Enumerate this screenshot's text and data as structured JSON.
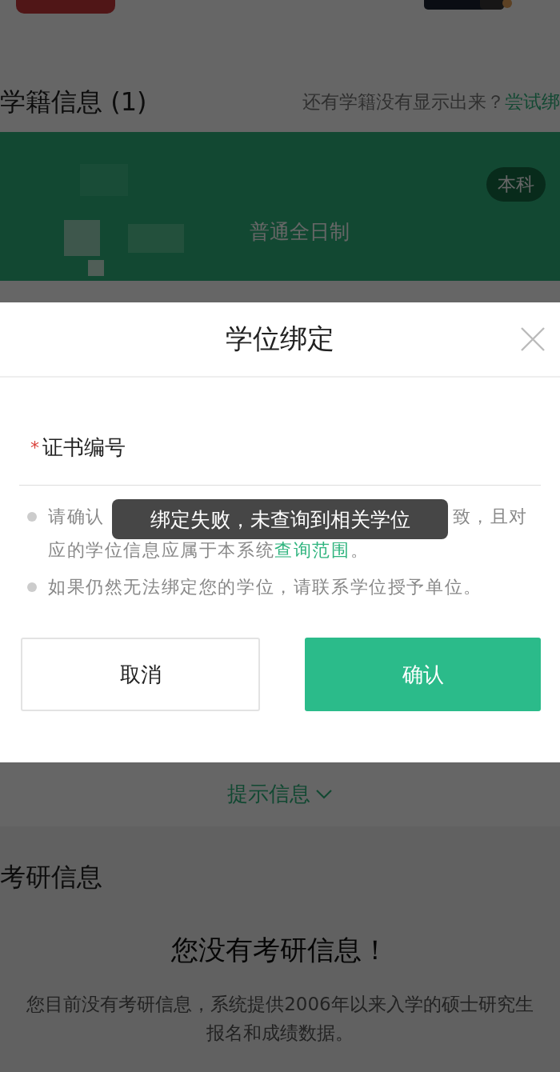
{
  "student_records": {
    "title": "学籍信息 (1)",
    "hint": "还有学籍没有显示出来？",
    "link": "尝试绑"
  },
  "record_card": {
    "badge": "本科",
    "study_mode": "普通全日制"
  },
  "hint_toggle": {
    "label": "提示信息",
    "expanded": false
  },
  "postgrad": {
    "title": "考研信息",
    "empty_title": "您没有考研信息！",
    "empty_text": "您目前没有考研信息，系统提供2006年以来入学的硕士研究生报名和成绩数据。"
  },
  "dialog": {
    "title": "学位绑定",
    "field": {
      "label": "证书编号",
      "required_mark": "*"
    },
    "notes": [
      {
        "kind": "covered",
        "start": "请确认",
        "end": "致，且对",
        "continued": "应的学位信息应属于本系统",
        "link": "查询范围",
        "after": "。"
      },
      {
        "kind": "plain",
        "text": "如果仍然无法绑定您的学位，请联系学位授予单位。"
      }
    ],
    "buttons": [
      {
        "label": "取消",
        "kind": "secondary"
      },
      {
        "label": "确认",
        "kind": "primary"
      }
    ]
  },
  "toast": "绑定失败，未查询到相关学位"
}
